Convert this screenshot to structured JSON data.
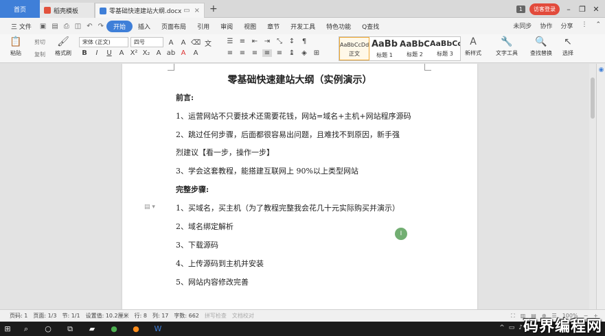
{
  "titlebar": {
    "tabs": [
      {
        "label": "首页",
        "color": "#3f7fd8"
      },
      {
        "label": "稻壳模板",
        "color": "#e2523c"
      },
      {
        "label": "零基础快速建站大纲.docx",
        "color": "#3f7fd8"
      }
    ],
    "new_tab": "+",
    "page_count": "1",
    "login": "访客登录"
  },
  "menubar": {
    "file": "三 文件",
    "items": [
      "开始",
      "插入",
      "页面布局",
      "引用",
      "审阅",
      "视图",
      "章节",
      "开发工具",
      "特色功能"
    ],
    "active": "开始",
    "search": "Q查找",
    "sync": "未同步",
    "collab": "协作",
    "share": "分享"
  },
  "ribbon": {
    "paste": "粘贴",
    "cut": "剪切",
    "copy": "复制",
    "format_painter": "格式刷",
    "font_name": "宋体 (正文)",
    "font_size": "四号",
    "styles": [
      {
        "sample": "AaBbCcDd",
        "name": "正文"
      },
      {
        "sample": "AaBb",
        "name": "标题 1"
      },
      {
        "sample": "AaBbC",
        "name": "标题 2"
      },
      {
        "sample": "AaBbCc",
        "name": "标题 3"
      }
    ],
    "new_style": "新样式",
    "text_tools": "文字工具",
    "find_replace": "查找替换",
    "select": "选择"
  },
  "document": {
    "title": "零基础快速建站大纲（实例演示）",
    "lines": [
      {
        "text": "前言:",
        "heading": true
      },
      {
        "text": "1、运营网站不只要技术还需要花钱，网站=域名+主机+网站程序源码",
        "heading": false
      },
      {
        "text": "2、跳过任何步骤，后面都很容易出问题，且难找不到原因，新手强",
        "heading": false
      },
      {
        "text": "烈建议【看一步，操作一步】",
        "heading": false
      },
      {
        "text": "3、学会这套教程，能搭建互联网上 90%以上类型网站",
        "heading": false
      },
      {
        "text": "完整步骤:",
        "heading": true
      },
      {
        "text": "1、买域名，买主机（为了教程完整我会花几十元实际购买并演示）",
        "heading": false
      },
      {
        "text": "2、域名绑定解析",
        "heading": false
      },
      {
        "text": "3、下载源码",
        "heading": false
      },
      {
        "text": "4、上传源码到主机并安装",
        "heading": false
      },
      {
        "text": "5、网站内容修改完善",
        "heading": false
      }
    ]
  },
  "status": {
    "page_no": "页码: 1",
    "pages": "页面: 1/3",
    "section": "节: 1/1",
    "setting": "设置值: 10.2厘米",
    "row": "行: 8",
    "col": "列: 17",
    "words": "字数: 662",
    "spell": "拼写检查",
    "compare": "文档校对",
    "zoom": "100%"
  },
  "watermark": "码界编程网"
}
